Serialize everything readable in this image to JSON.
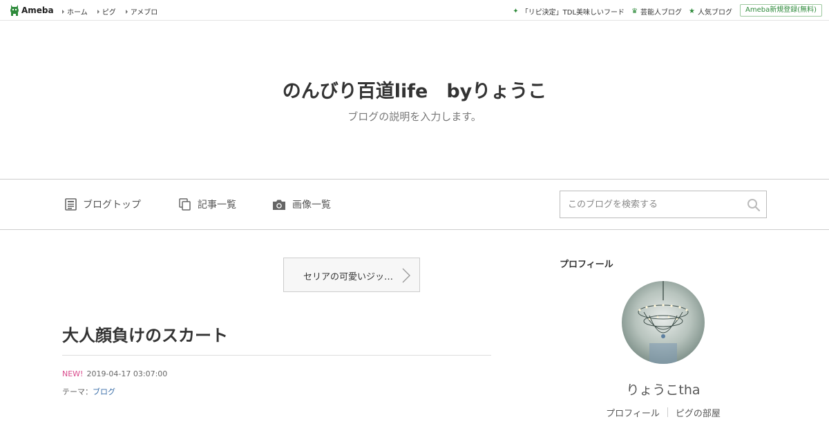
{
  "topbar": {
    "logo_text": "Ameba",
    "nav": [
      "ホーム",
      "ピグ",
      "アメブロ"
    ],
    "right_nav": [
      {
        "icon": "sparkle-icon",
        "label": "「リピ決定」TDL美味しいフード"
      },
      {
        "icon": "crown-icon",
        "label": "芸能人ブログ"
      },
      {
        "icon": "star-icon",
        "label": "人気ブログ"
      }
    ],
    "register_label": "Ameba新規登録(無料)",
    "accent_color": "#2d8a3a"
  },
  "header": {
    "title": "のんびり百道life　byりょうこ",
    "description": "ブログの説明を入力します。"
  },
  "navbar": {
    "blog_top": "ブログトップ",
    "entries": "記事一覧",
    "images": "画像一覧",
    "search_placeholder": "このブログを検索する"
  },
  "main": {
    "prev_entry": "セリアの可愛いジッ…",
    "entry_title": "大人顔負けのスカート",
    "new_badge": "NEW!",
    "date": "2019-04-17 03:07:00",
    "theme_label": "テーマ：",
    "theme_value": "ブログ"
  },
  "sidebar": {
    "heading": "プロフィール",
    "name": "りょうこtha",
    "links": [
      "プロフィール",
      "ピグの部屋"
    ]
  }
}
